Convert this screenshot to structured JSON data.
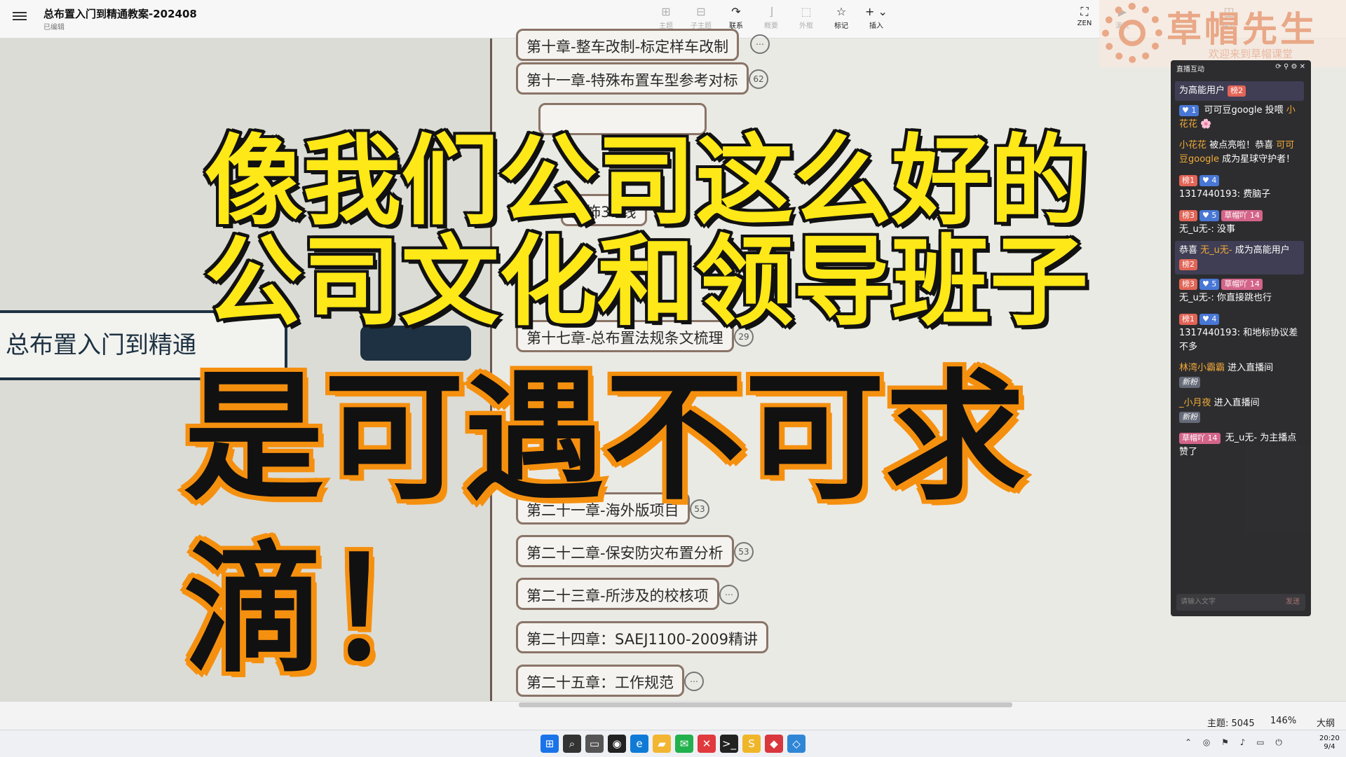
{
  "app": {
    "doc_title": "总布置入门到精通教案-202408",
    "doc_status": "已编辑"
  },
  "toolbar": {
    "items": [
      {
        "icon": "topic-icon",
        "glyph": "⊞",
        "label": "主题",
        "enabled": false
      },
      {
        "icon": "subtopic-icon",
        "glyph": "⊟",
        "label": "子主题",
        "enabled": false
      },
      {
        "icon": "relationship-icon",
        "glyph": "↷",
        "label": "联系",
        "enabled": true
      },
      {
        "icon": "summary-icon",
        "glyph": "⌋",
        "label": "概要",
        "enabled": false
      },
      {
        "icon": "boundary-icon",
        "glyph": "⬚",
        "label": "外框",
        "enabled": false
      },
      {
        "icon": "marker-star-icon",
        "glyph": "☆",
        "label": "标记",
        "enabled": true
      },
      {
        "icon": "insert-plus-icon",
        "glyph": "+ ⌄",
        "label": "插入",
        "enabled": true
      }
    ],
    "right_items": [
      {
        "icon": "zen-fullscreen-icon",
        "glyph": "⛶",
        "label": "ZEN"
      },
      {
        "icon": "presentation-icon",
        "glyph": "▶",
        "label": "演说"
      },
      {
        "icon": "format-panel-icon",
        "glyph": "◫",
        "label": "格式"
      }
    ]
  },
  "watermark": {
    "name": "草帽先生",
    "slogan": "欢迎来到草帽课堂"
  },
  "mindmap": {
    "root_label": "总布置入门到精通",
    "branches": [
      {
        "label": "第十章-整车改制-标定样车改制",
        "badge": "⋯"
      },
      {
        "label": "第十一章-特殊布置车型参考对标",
        "badge": "62"
      },
      {
        "label": "外饰3D线",
        "badge": ""
      },
      {
        "label": "第十七章-总布置法规条文梳理",
        "badge": "29"
      },
      {
        "label": "第二十一章-海外版项目",
        "badge": "53"
      },
      {
        "label": "第二十二章-保安防灾布置分析",
        "badge": "53"
      },
      {
        "label": "第二十三章-所涉及的校核项",
        "badge": "⋯"
      },
      {
        "label": "第二十四章：SAEJ1100-2009精讲",
        "badge": ""
      },
      {
        "label": "第二十五章：工作规范",
        "badge": "⋯"
      }
    ]
  },
  "captions": {
    "line1": "像我们公司这么好的",
    "line2": "公司文化和领导班子",
    "line3": "是可遇不可求",
    "line4": "滴！"
  },
  "chat": {
    "header": "直播互动",
    "messages": [
      {
        "type": "highlight",
        "parts": [
          {
            "text": "为高能用户 "
          },
          {
            "tag": "rank",
            "text": "榜2"
          }
        ]
      },
      {
        "type": "normal",
        "parts": [
          {
            "tag": "lv",
            "text": "♥ 1"
          },
          {
            "text": " 可可豆google 投喂 "
          },
          {
            "nick": "小花花"
          },
          {
            "text": " 🌸"
          }
        ]
      },
      {
        "type": "normal",
        "parts": [
          {
            "nick": "小花花"
          },
          {
            "text": " 被点亮啦！恭喜 "
          },
          {
            "nick": "可可豆google"
          },
          {
            "text": " 成为星球守护者！"
          }
        ]
      },
      {
        "type": "normal",
        "parts": [
          {
            "tag": "rank",
            "text": "榜1"
          },
          {
            "tag": "lv",
            "text": "♥ 4"
          },
          {
            "br": true
          },
          {
            "text": "1317440193: 费脑子"
          }
        ]
      },
      {
        "type": "normal",
        "parts": [
          {
            "tag": "rank",
            "text": "榜3"
          },
          {
            "tag": "lv",
            "text": "♥ 5"
          },
          {
            "tag": "fan",
            "text": "草帽吖 14"
          },
          {
            "br": true
          },
          {
            "text": "无_u无-: 没事"
          }
        ]
      },
      {
        "type": "highlight",
        "parts": [
          {
            "text": "恭喜 "
          },
          {
            "nick": "无_u无-"
          },
          {
            "text": " 成为高能用户 "
          },
          {
            "tag": "rank",
            "text": "榜2"
          }
        ]
      },
      {
        "type": "normal",
        "parts": [
          {
            "tag": "rank",
            "text": "榜3"
          },
          {
            "tag": "lv",
            "text": "♥ 5"
          },
          {
            "tag": "fan",
            "text": "草帽吖 14"
          },
          {
            "br": true
          },
          {
            "text": "无_u无-: 你直接跳也行"
          }
        ]
      },
      {
        "type": "normal",
        "parts": [
          {
            "tag": "rank",
            "text": "榜1"
          },
          {
            "tag": "lv",
            "text": "♥ 4"
          },
          {
            "br": true
          },
          {
            "text": "1317440193: 和地标协议差不多"
          }
        ]
      },
      {
        "type": "normal",
        "parts": [
          {
            "nick": "林湾小霸霸"
          },
          {
            "text": " 进入直播间"
          },
          {
            "br": true
          },
          {
            "tag": "new",
            "text": "新粉"
          }
        ]
      },
      {
        "type": "normal",
        "parts": [
          {
            "nick": "_小月夜"
          },
          {
            "text": " 进入直播间"
          },
          {
            "br": true
          },
          {
            "tag": "new",
            "text": "新粉"
          }
        ]
      },
      {
        "type": "normal",
        "parts": [
          {
            "tag": "fan",
            "text": "草帽吖 14"
          },
          {
            "text": " 无_u无- 为主播点赞了"
          }
        ]
      }
    ],
    "input_placeholder": "请输入文字",
    "send_label": "发送"
  },
  "statusbar": {
    "topics": "主题: 5045",
    "zoom": "146%",
    "outline": "大纲"
  },
  "taskbar": {
    "apps": [
      {
        "icon": "windows-start-icon",
        "glyph": "⊞",
        "color": "#1a73e8"
      },
      {
        "icon": "search-icon",
        "glyph": "⌕",
        "color": "#333333"
      },
      {
        "icon": "task-view-icon",
        "glyph": "▭",
        "color": "#555555"
      },
      {
        "icon": "obs-app-icon",
        "glyph": "◉",
        "color": "#222222"
      },
      {
        "icon": "edge-browser-icon",
        "glyph": "e",
        "color": "#0f7bd6"
      },
      {
        "icon": "file-explorer-icon",
        "glyph": "▰",
        "color": "#f2b632"
      },
      {
        "icon": "wechat-icon",
        "glyph": "✉",
        "color": "#22b14c"
      },
      {
        "icon": "xmind-app-icon",
        "glyph": "✕",
        "color": "#e0393e"
      },
      {
        "icon": "terminal-icon",
        "glyph": ">_",
        "color": "#222222"
      },
      {
        "icon": "sw-app-icon",
        "glyph": "S",
        "color": "#f0b62a"
      },
      {
        "icon": "red-app-icon",
        "glyph": "◆",
        "color": "#d9363e"
      },
      {
        "icon": "blue-app-icon",
        "glyph": "◇",
        "color": "#2f86d6"
      }
    ],
    "time": "20:20",
    "date": "9/4"
  }
}
